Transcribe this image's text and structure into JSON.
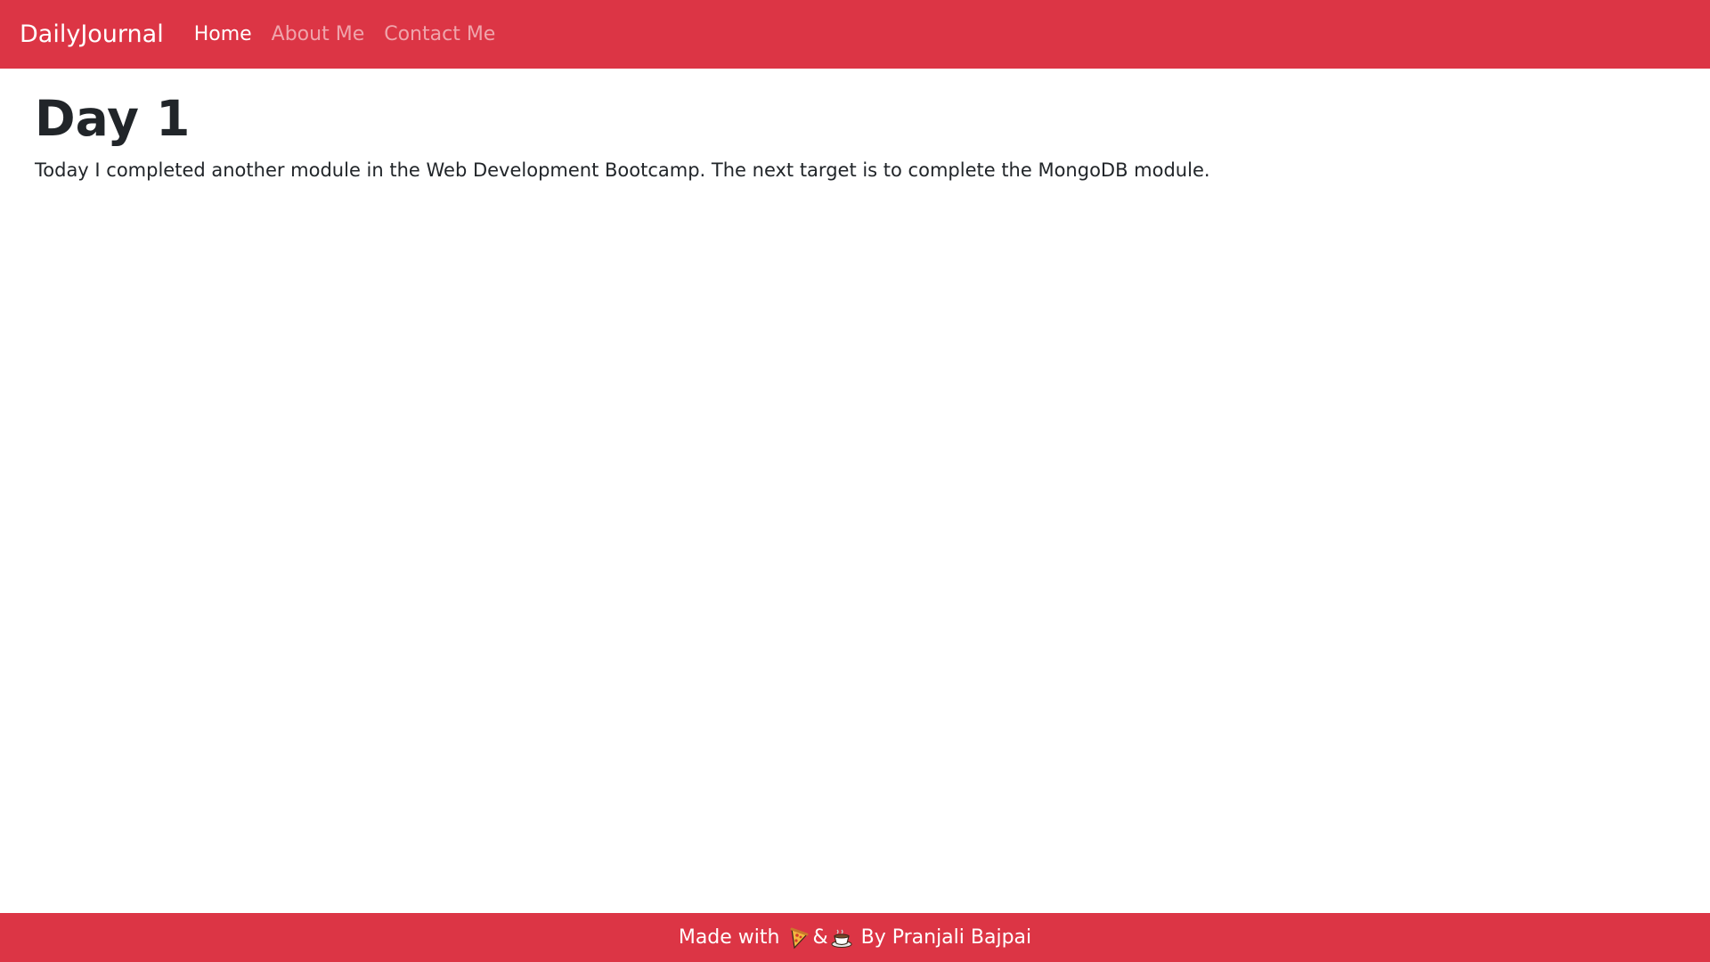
{
  "navbar": {
    "brand": "DailyJournal",
    "links": [
      {
        "label": "Home",
        "active": true
      },
      {
        "label": "About Me",
        "active": false
      },
      {
        "label": "Contact Me",
        "active": false
      }
    ]
  },
  "post": {
    "title": "Day 1",
    "body": "Today I completed another module in the Web Development Bootcamp. The next target is to complete the MongoDB module."
  },
  "footer": {
    "prefix": "Made with ",
    "ampersand": "&",
    "suffix": " By Pranjali Bajpai",
    "icons": [
      "pizza-icon",
      "coffee-icon"
    ]
  },
  "colors": {
    "accent": "#dc3545",
    "text": "#212529",
    "background": "#ffffff"
  }
}
